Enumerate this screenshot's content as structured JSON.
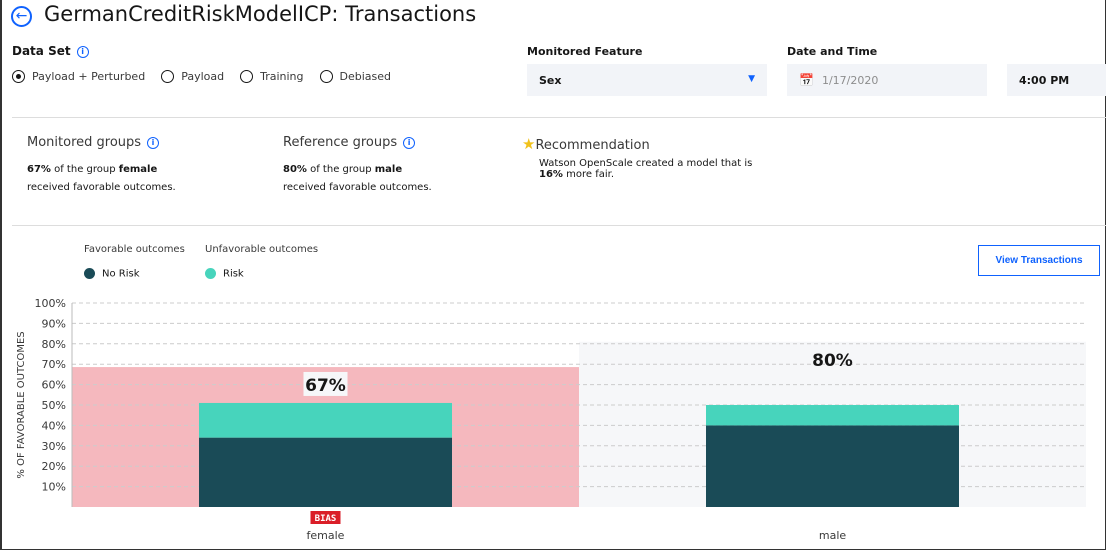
{
  "header": {
    "title": "GermanCreditRiskModelICP: Transactions",
    "back_icon": "arrow-left-circle-icon"
  },
  "dataset": {
    "label": "Data Set",
    "options": [
      "Payload + Perturbed",
      "Payload",
      "Training",
      "Debiased"
    ],
    "selected": "Payload + Perturbed"
  },
  "monitored_feature": {
    "label": "Monitored Feature",
    "value": "Sex"
  },
  "date_time": {
    "label": "Date and Time",
    "date": "1/17/2020",
    "time": "4:00 PM"
  },
  "monitored_groups": {
    "title": "Monitored groups",
    "pct": "67%",
    "text1": " of the group ",
    "group": "female",
    "text2": "received favorable outcomes."
  },
  "reference_groups": {
    "title": "Reference groups",
    "pct": "80%",
    "text1": " of the group ",
    "group": "male",
    "text2": "received favorable outcomes."
  },
  "recommendation": {
    "title": "Recommendation",
    "text1": "Watson OpenScale created a model that is",
    "pct": "16%",
    "text2": " more fair."
  },
  "legend": {
    "favorable_label": "Favorable outcomes",
    "unfavorable_label": "Unfavorable outcomes",
    "favorable_item": "No Risk",
    "unfavorable_item": "Risk"
  },
  "view_transactions": "View Transactions",
  "colors": {
    "no_risk": "#1a4b57",
    "risk": "#47d4bc",
    "bias_region": "#f5b8be",
    "reference_region": "#f6f7f9",
    "bias_badge": "#da1e28",
    "accent": "#0f62fe"
  },
  "chart_data": {
    "type": "bar",
    "stacked": true,
    "ylabel": "% OF FAVORABLE OUTCOMES",
    "ylim": [
      0,
      100
    ],
    "yticks": [
      "10%",
      "20%",
      "30%",
      "40%",
      "50%",
      "60%",
      "70%",
      "80%",
      "90%",
      "100%"
    ],
    "grid": true,
    "categories": [
      "female",
      "male"
    ],
    "series": [
      {
        "name": "No Risk",
        "values": [
          34,
          40
        ]
      },
      {
        "name": "Risk",
        "values": [
          17,
          10
        ]
      }
    ],
    "group_rates": [
      {
        "label": "67%",
        "value": 67,
        "badge": "BIAS"
      },
      {
        "label": "80%",
        "value": 80,
        "badge": ""
      }
    ]
  }
}
